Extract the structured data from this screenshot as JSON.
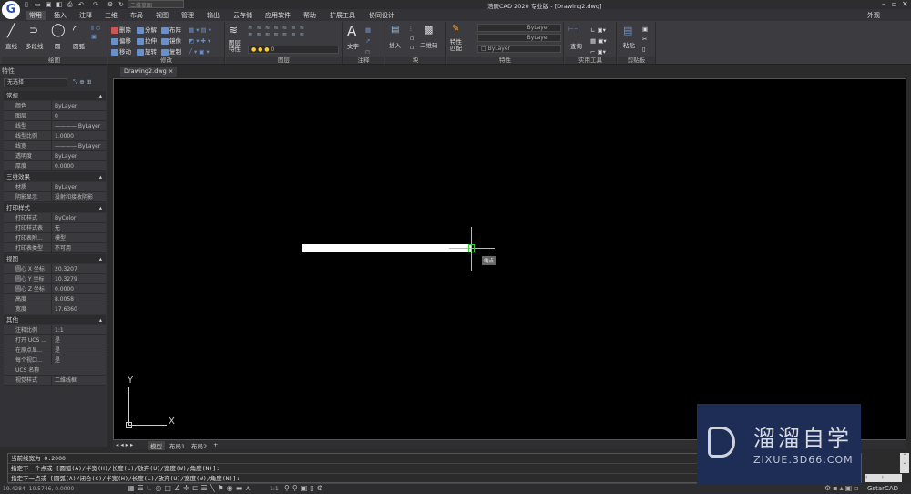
{
  "titlebar": {
    "workspace": "二维草图",
    "app_title": "浩辰CAD 2020 专业版 - [Drawing2.dwg]",
    "appearance": "外观"
  },
  "menu": [
    "常用",
    "插入",
    "注释",
    "三维",
    "布局",
    "视图",
    "管理",
    "输出",
    "云存储",
    "应用软件",
    "帮助",
    "扩展工具",
    "协同设计"
  ],
  "ribbon": {
    "draw": {
      "label": "绘图",
      "tools": [
        "直线",
        "多段线",
        "圆",
        "圆弧"
      ]
    },
    "modify": {
      "label": "修改",
      "tools": [
        "删除",
        "分解",
        "布阵",
        "偏移",
        "拉伸",
        "镜像",
        "移动",
        "旋转",
        "复制"
      ]
    },
    "layers": {
      "label": "图层",
      "big": "图层特性",
      "combo": "0"
    },
    "annot": {
      "label": "注释",
      "big": "文字"
    },
    "block": {
      "label": "块",
      "tools": [
        "插入",
        "二维码"
      ]
    },
    "props": {
      "label": "特性",
      "big": "特性匹配",
      "combo1": "ByLayer",
      "combo2": "ByLayer",
      "combo3": "ByLayer"
    },
    "util": {
      "label": "实用工具",
      "big": "查询"
    },
    "clip": {
      "label": "剪贴板",
      "big": "粘贴"
    }
  },
  "doc_tab": "Drawing2.dwg",
  "properties": {
    "title": "特性",
    "selection": "无选择",
    "sections": [
      {
        "name": "常规",
        "rows": [
          [
            "颜色",
            "ByLayer"
          ],
          [
            "图层",
            "0"
          ],
          [
            "线型",
            "———— ByLayer"
          ],
          [
            "线型比例",
            "1.0000"
          ],
          [
            "线宽",
            "———— ByLayer"
          ],
          [
            "透明度",
            "ByLayer"
          ],
          [
            "厚度",
            "0.0000"
          ]
        ]
      },
      {
        "name": "三维效果",
        "rows": [
          [
            "材质",
            "ByLayer"
          ],
          [
            "阴影显示",
            "投射和接收阴影"
          ]
        ]
      },
      {
        "name": "打印样式",
        "rows": [
          [
            "打印样式",
            "ByColor"
          ],
          [
            "打印样式表",
            "无"
          ],
          [
            "打印表附...",
            "模型"
          ],
          [
            "打印表类型",
            "不可用"
          ]
        ]
      },
      {
        "name": "视图",
        "rows": [
          [
            "圆心 X 坐标",
            "20.3207"
          ],
          [
            "圆心 Y 坐标",
            "10.3279"
          ],
          [
            "圆心 Z 坐标",
            "0.0000"
          ],
          [
            "高度",
            "8.0058"
          ],
          [
            "宽度",
            "17.6360"
          ]
        ]
      },
      {
        "name": "其他",
        "rows": [
          [
            "注释比例",
            "1:1"
          ],
          [
            "打开 UCS ...",
            "是"
          ],
          [
            "在原点显...",
            "是"
          ],
          [
            "每个视口...",
            "是"
          ],
          [
            "UCS 名称",
            ""
          ],
          [
            "视觉样式",
            "二维线框"
          ]
        ]
      }
    ]
  },
  "canvas": {
    "snap_tooltip": "端点",
    "ucs_x": "X",
    "ucs_y": "Y"
  },
  "layout_tabs": [
    "模型",
    "布局1",
    "布局2"
  ],
  "command": {
    "lines": [
      "当前线宽为 0.2000",
      "指定下一个点或 [圆弧(A)/半宽(H)/长度(L)/放弃(U)/宽度(W)/角度(N)]:",
      "指定下一点或 [圆弧(A)/闭合(C)/半宽(H)/长度(L)/放弃(U)/宽度(W)/角度(N)]:"
    ]
  },
  "status": {
    "coords": "19.4284, 10.5746, 0.0000",
    "scale": "1:1",
    "brand": "GstarCAD"
  },
  "watermark": {
    "name": "溜溜自学",
    "url": "ZIXUE.3D66.COM"
  },
  "colors": {
    "canvas": "#000000",
    "panel": "#333337",
    "accent": "#2a4fb8",
    "watermark": "#1e2d55"
  }
}
